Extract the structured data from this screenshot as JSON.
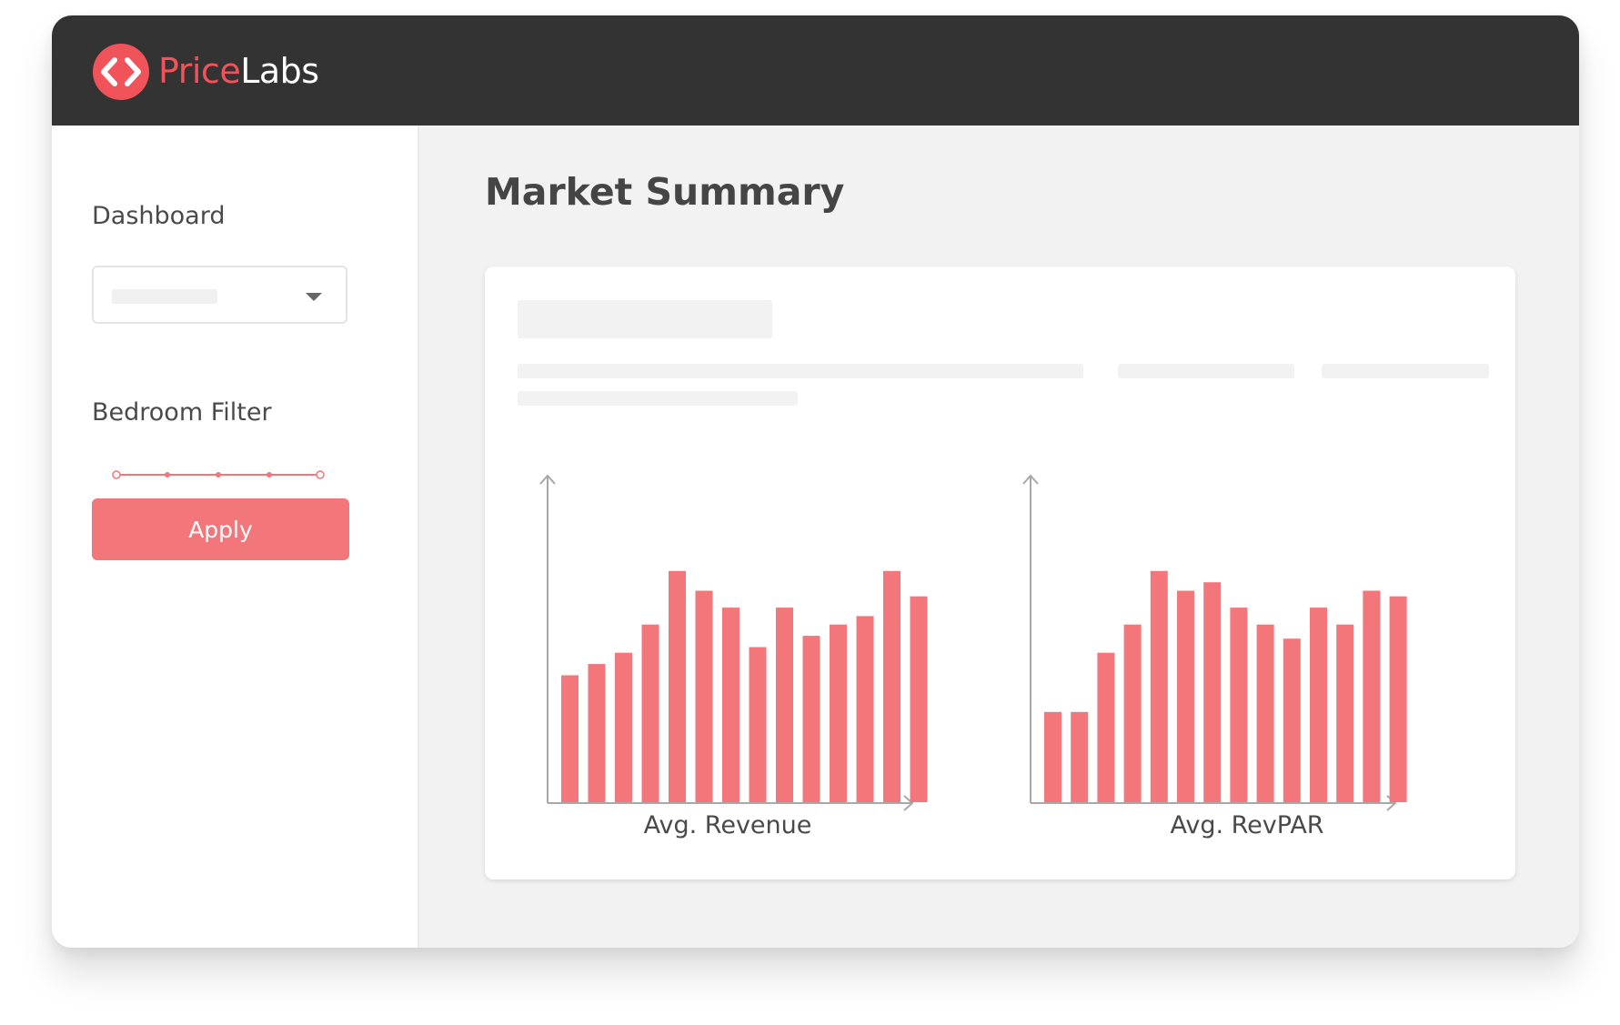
{
  "brand": {
    "name_part1": "Price",
    "name_part2": "Labs",
    "accent_color": "#f0535a",
    "logo_icon": "code-brackets-icon"
  },
  "sidebar": {
    "dashboard_label": "Dashboard",
    "dashboard_select_value": "",
    "bedroom_filter_label": "Bedroom Filter",
    "bedroom_slider_stops": 5,
    "apply_label": "Apply"
  },
  "main": {
    "title": "Market Summary"
  },
  "colors": {
    "bar": "#f3767b",
    "axis": "#a8a8a8",
    "topbar": "#333333"
  },
  "chart_data": [
    {
      "type": "bar",
      "xlabel": "Avg. Revenue",
      "values": [
        45,
        49,
        53,
        63,
        82,
        75,
        69,
        55,
        69,
        59,
        63,
        66,
        82,
        73
      ],
      "ylim": [
        0,
        100
      ],
      "grid": false
    },
    {
      "type": "bar",
      "xlabel": "Avg. RevPAR",
      "values": [
        32,
        32,
        53,
        63,
        82,
        75,
        78,
        69,
        63,
        58,
        69,
        63,
        75,
        73
      ],
      "ylim": [
        0,
        100
      ],
      "grid": false
    }
  ]
}
